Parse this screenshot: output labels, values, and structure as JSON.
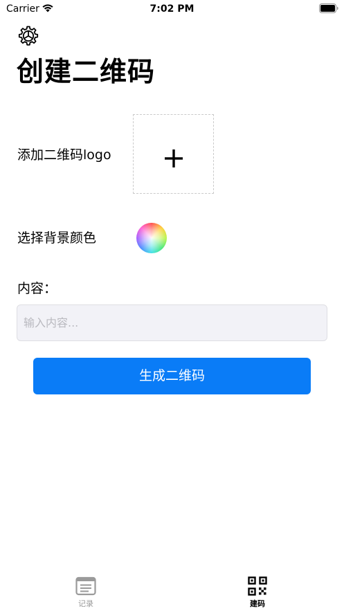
{
  "status_bar": {
    "carrier": "Carrier",
    "time": "7:02 PM",
    "wifi_icon": "wifi-icon",
    "battery_icon": "battery-icon"
  },
  "header": {
    "settings_icon": "gear-icon",
    "title": "创建二维码"
  },
  "form": {
    "logo_label": "添加二维码logo",
    "logo_add_icon": "plus-icon",
    "background_label": "选择背景颜色",
    "color_picker_icon": "color-wheel-icon",
    "content_label": "内容：",
    "content_value": "",
    "content_placeholder": "输入内容..."
  },
  "actions": {
    "generate_label": "生成二维码",
    "generate_color": "#0a7cf7"
  },
  "tab_bar": {
    "tabs": [
      {
        "label": "记录",
        "icon": "document-list-icon",
        "selected": false
      },
      {
        "label": "建码",
        "icon": "qr-code-icon",
        "selected": true
      }
    ]
  }
}
